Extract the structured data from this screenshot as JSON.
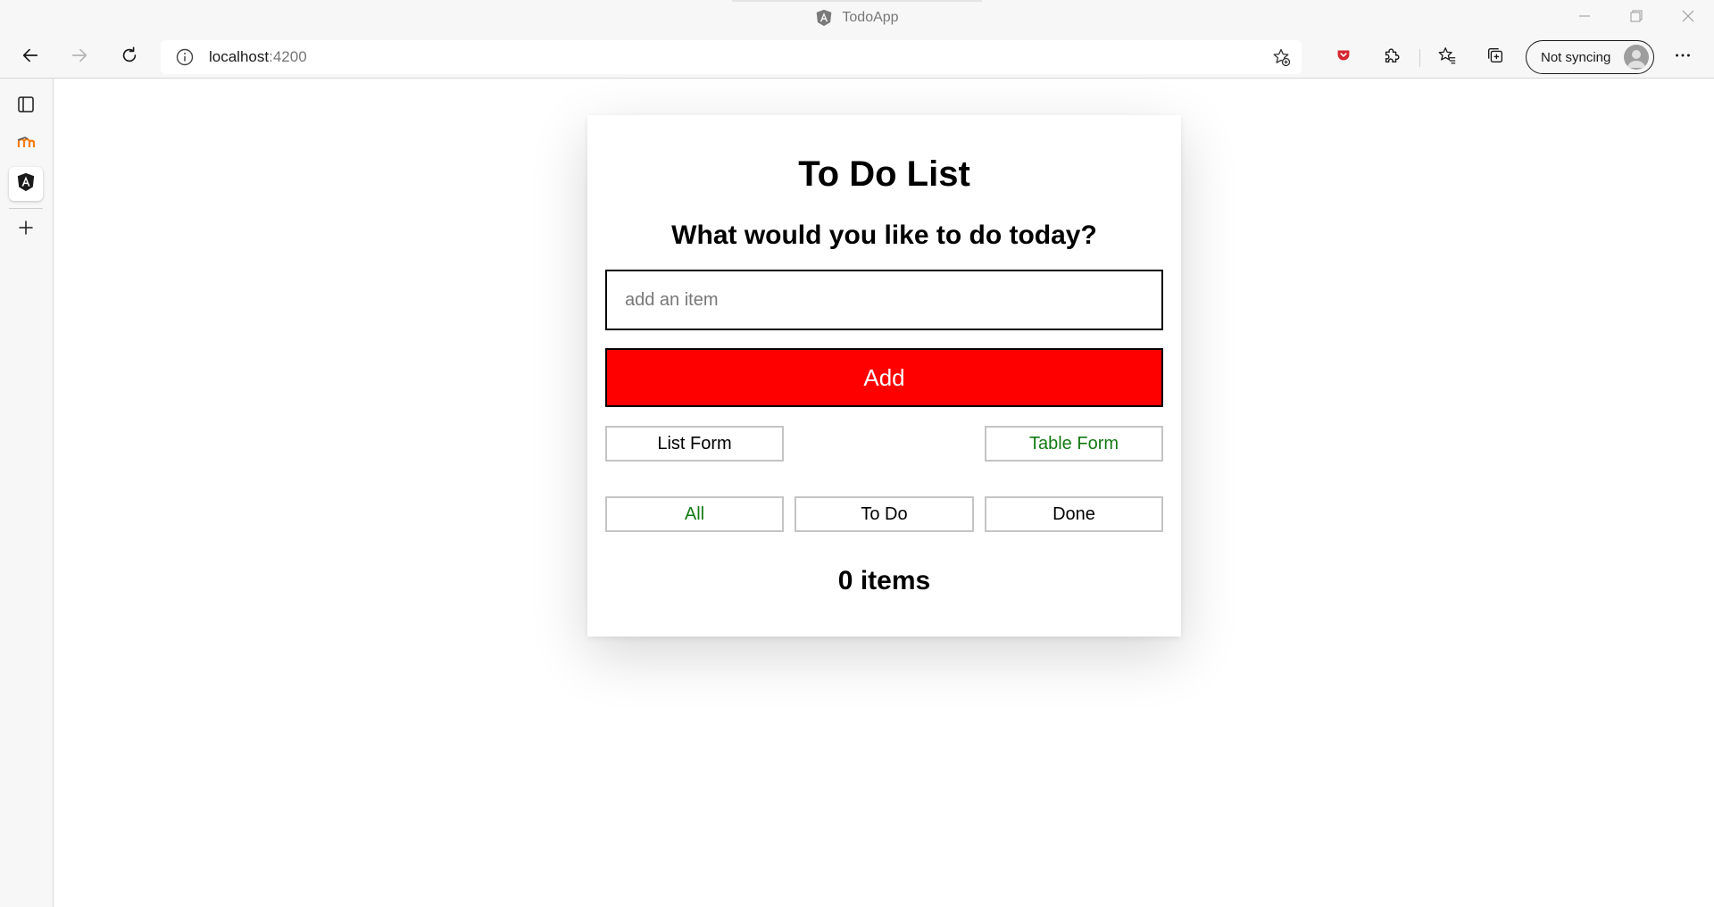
{
  "window": {
    "title": "TodoApp",
    "controls": [
      "minimize-icon",
      "restore-icon",
      "close-icon"
    ]
  },
  "toolbar": {
    "url_host": "localhost",
    "url_port": ":4200",
    "sync_label": "Not syncing"
  },
  "sidebar": {
    "items": [
      "tab-actions-icon",
      "moodle-icon",
      "angular-icon",
      "add-icon"
    ]
  },
  "app": {
    "heading": "To Do List",
    "subheading": "What would you like to do today?",
    "input_placeholder": "add an item",
    "add_label": "Add",
    "view_modes": [
      {
        "label": "List Form",
        "selected": false
      },
      {
        "label": "Table Form",
        "selected": true
      }
    ],
    "filters": [
      {
        "label": "All",
        "selected": true
      },
      {
        "label": "To Do",
        "selected": false
      },
      {
        "label": "Done",
        "selected": false
      }
    ],
    "items_count": "0 items"
  },
  "colors": {
    "add_button": "#ff0000",
    "selected_text": "#137a13",
    "chrome_background": "#f7f7f7"
  }
}
